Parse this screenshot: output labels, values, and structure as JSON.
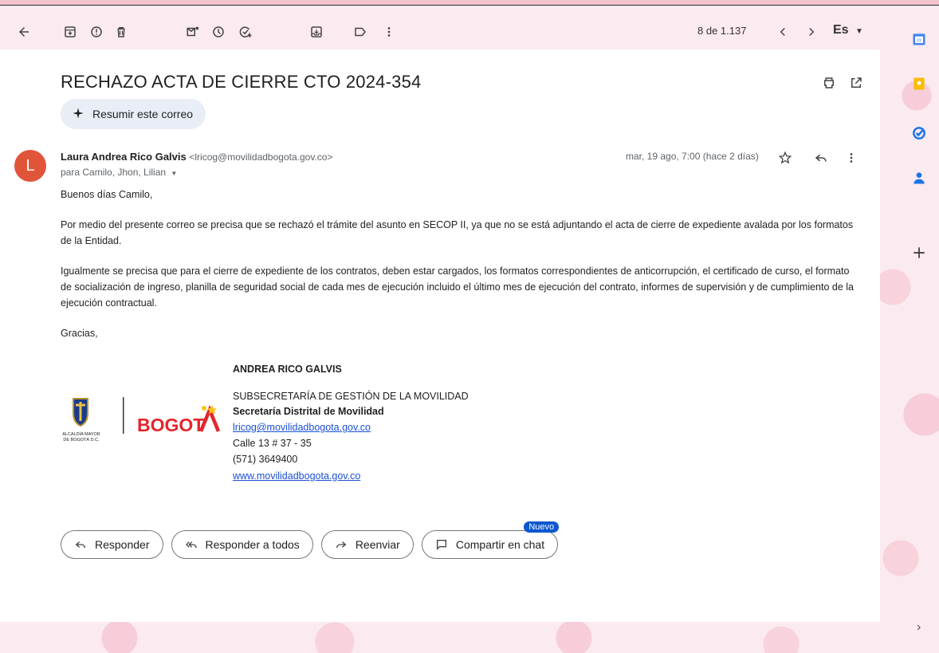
{
  "pager": "8 de 1.137",
  "language": "Es",
  "subject": "RECHAZO ACTA DE CIERRE CTO 2024-354",
  "summarize_label": "Resumir este correo",
  "sender": {
    "initial": "L",
    "name": "Laura Andrea Rico Galvis",
    "email": "<lricog@movilidadbogota.gov.co>",
    "recipients": "para Camilo, Jhon, Lilian",
    "date": "mar, 19 ago, 7:00 (hace 2 días)"
  },
  "body": {
    "greeting": "Buenos días Camilo,",
    "p1": "Por medio del presente correo se precisa que se rechazó el trámite del asunto en SECOP II, ya que no se está adjuntando el acta de cierre de expediente avalada por los formatos de la Entidad.",
    "p2": "Igualmente se precisa que para el cierre de expediente de los contratos, deben estar cargados, los formatos correspondientes de anticorrupción, el certificado de curso, el formato de socialización de ingreso, planilla de seguridad social de cada mes de ejecución incluido el último mes de ejecución del contrato, informes de supervisión y de cumplimiento de la ejecución contractual.",
    "closing": "Gracias,"
  },
  "signature": {
    "name": "ANDREA RICO GALVIS",
    "dept": "SUBSECRETARÍA DE GESTIÓN DE LA MOVILIDAD",
    "org": "Secretaría Distrital de Movilidad",
    "email": "lricog@movilidadbogota.gov.co",
    "address": "Calle 13 # 37 - 35",
    "phone": "(571) 3649400",
    "web": "www.movilidadbogota.gov.co",
    "logo_small_text": "ALCALDÍA MAYOR DE BOGOTÁ D.C.",
    "logo_brand": "BOGOTA"
  },
  "actions": {
    "reply": "Responder",
    "reply_all": "Responder a todos",
    "forward": "Reenviar",
    "share": "Compartir en chat",
    "new_badge": "Nuevo"
  },
  "colors": {
    "accent": "#0b57d0",
    "avatar": "#e0553a",
    "link": "#1a4fd6"
  },
  "rail_icons": [
    "calendar-icon",
    "keep-icon",
    "tasks-icon",
    "contacts-icon",
    "add-icon"
  ]
}
